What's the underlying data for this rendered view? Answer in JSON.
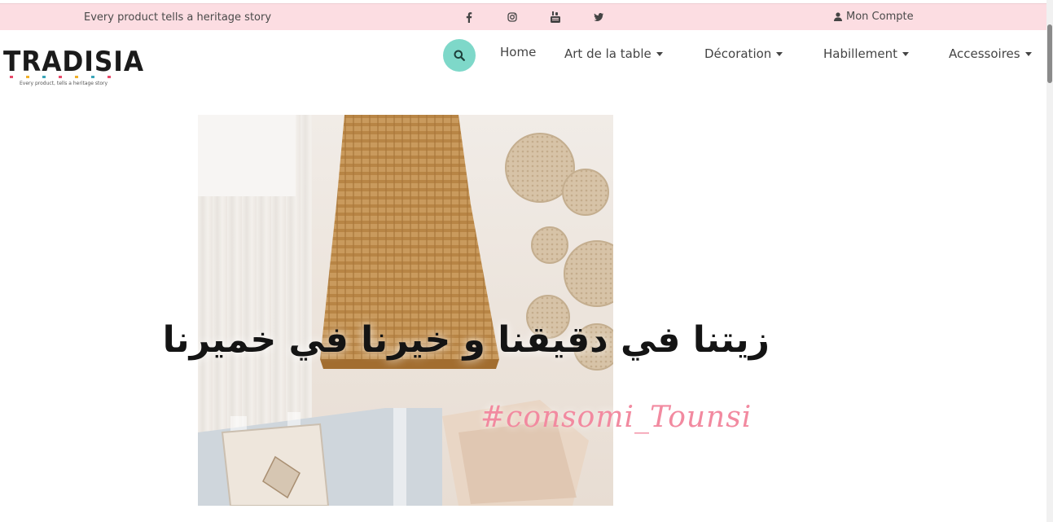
{
  "topbar": {
    "tagline": "Every product tells a heritage story",
    "socials": [
      "facebook-icon",
      "instagram-icon",
      "youtube-icon",
      "twitter-icon"
    ],
    "account_label": "Mon Compte",
    "background": "#fcdde2"
  },
  "header": {
    "logo_text": "TRADISIA",
    "logo_slogan": "Every product, tells a heritage story",
    "search_color": "#7ed8c9",
    "nav": {
      "home": "Home",
      "art_de_la_table": "Art de la table",
      "decoration": "Décoration",
      "habillement": "Habillement",
      "accessoires": "Accessoires"
    }
  },
  "hero": {
    "arabic_text": "زيتنا في دقيقنا و خيرنا في خميرنا",
    "hashtag": "#consomi_Tounsi",
    "hashtag_color": "#f28aa0"
  }
}
